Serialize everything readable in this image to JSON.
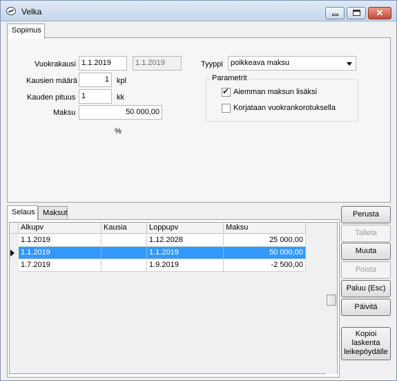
{
  "window": {
    "title": "Velka"
  },
  "top_tabs": [
    {
      "label": "Sopimus"
    }
  ],
  "form": {
    "vuokrakausi_label": "Vuokrakausi",
    "vuokrakausi_value": "1.1.2019",
    "vuokrakausi_end_value": "1.1.2019",
    "kausien_maara_label": "Kausien määrä",
    "kausien_maara_value": "1",
    "kausien_maara_unit": "kpl",
    "kauden_pituus_label": "Kauden pituus",
    "kauden_pituus_value": "1",
    "kauden_pituus_unit": "kk",
    "maksu_label": "Maksu",
    "maksu_value": "50 000,00",
    "percent_label": "%",
    "tyyppi_label": "Tyyppi",
    "tyyppi_value": "poikkeava maksu",
    "parametrit_legend": "Parametrit",
    "check_aiemman": {
      "label": "Aiemman maksun lisäksi",
      "checked": true
    },
    "check_korjataan": {
      "label": "Korjataan vuokrankorotuksella",
      "checked": false
    }
  },
  "bottom_tabs": [
    {
      "label": "Selaus"
    },
    {
      "label": "Maksut"
    }
  ],
  "grid": {
    "columns": [
      "Alkupv",
      "Kausia",
      "Loppupv",
      "Maksu"
    ],
    "rows": [
      {
        "alkupv": "1.1.2019",
        "kausia": "",
        "loppupv": "1.12.2028",
        "maksu": "25 000,00",
        "selected": false
      },
      {
        "alkupv": "1.1.2019",
        "kausia": "",
        "loppupv": "1.1.2019",
        "maksu": "50 000,00",
        "selected": true
      },
      {
        "alkupv": "1.7.2019",
        "kausia": "",
        "loppupv": "1.9.2019",
        "maksu": "-2 500,00",
        "selected": false
      }
    ]
  },
  "buttons": {
    "perusta": "Perusta",
    "talleta": "Talleta",
    "muuta": "Muuta",
    "poista": "Poista",
    "paluu": "Paluu (Esc)",
    "paivita": "Päivitä",
    "kopioi_line1": "Kopioi",
    "kopioi_line2": "laskenta",
    "kopioi_line3": "leikepöydälle"
  },
  "colors": {
    "selection": "#3399ff",
    "titlebar": "#c5d6ec"
  }
}
